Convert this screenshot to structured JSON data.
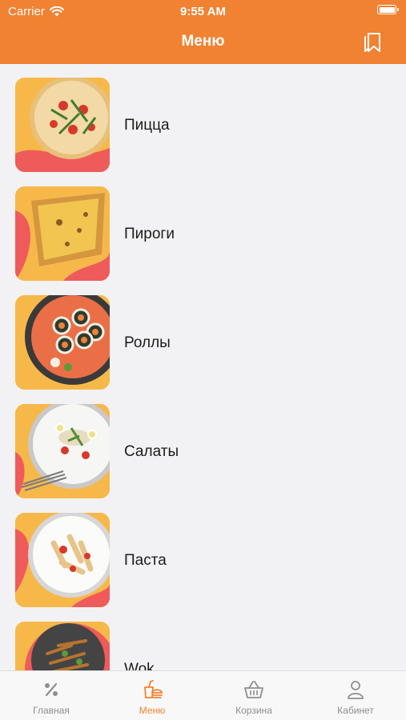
{
  "status_bar": {
    "carrier": "Carrier",
    "time": "9:55 AM"
  },
  "nav": {
    "title": "Меню",
    "bookmark_icon": "bookmark-icon"
  },
  "colors": {
    "accent": "#f08232",
    "background": "#f2f2f4",
    "tab_inactive": "#8e8e93"
  },
  "menu": {
    "items": [
      {
        "label": "Пицца",
        "icon": "pizza-image"
      },
      {
        "label": "Пироги",
        "icon": "pie-image"
      },
      {
        "label": "Роллы",
        "icon": "rolls-image"
      },
      {
        "label": "Салаты",
        "icon": "salad-image"
      },
      {
        "label": "Паста",
        "icon": "pasta-image"
      },
      {
        "label": "Wok",
        "icon": "wok-image"
      }
    ]
  },
  "tabbar": {
    "tabs": [
      {
        "label": "Главная",
        "icon": "percent-icon",
        "active": false
      },
      {
        "label": "Меню",
        "icon": "menu-food-icon",
        "active": true
      },
      {
        "label": "Корзина",
        "icon": "basket-icon",
        "active": false
      },
      {
        "label": "Кабинет",
        "icon": "user-icon",
        "active": false
      }
    ]
  }
}
